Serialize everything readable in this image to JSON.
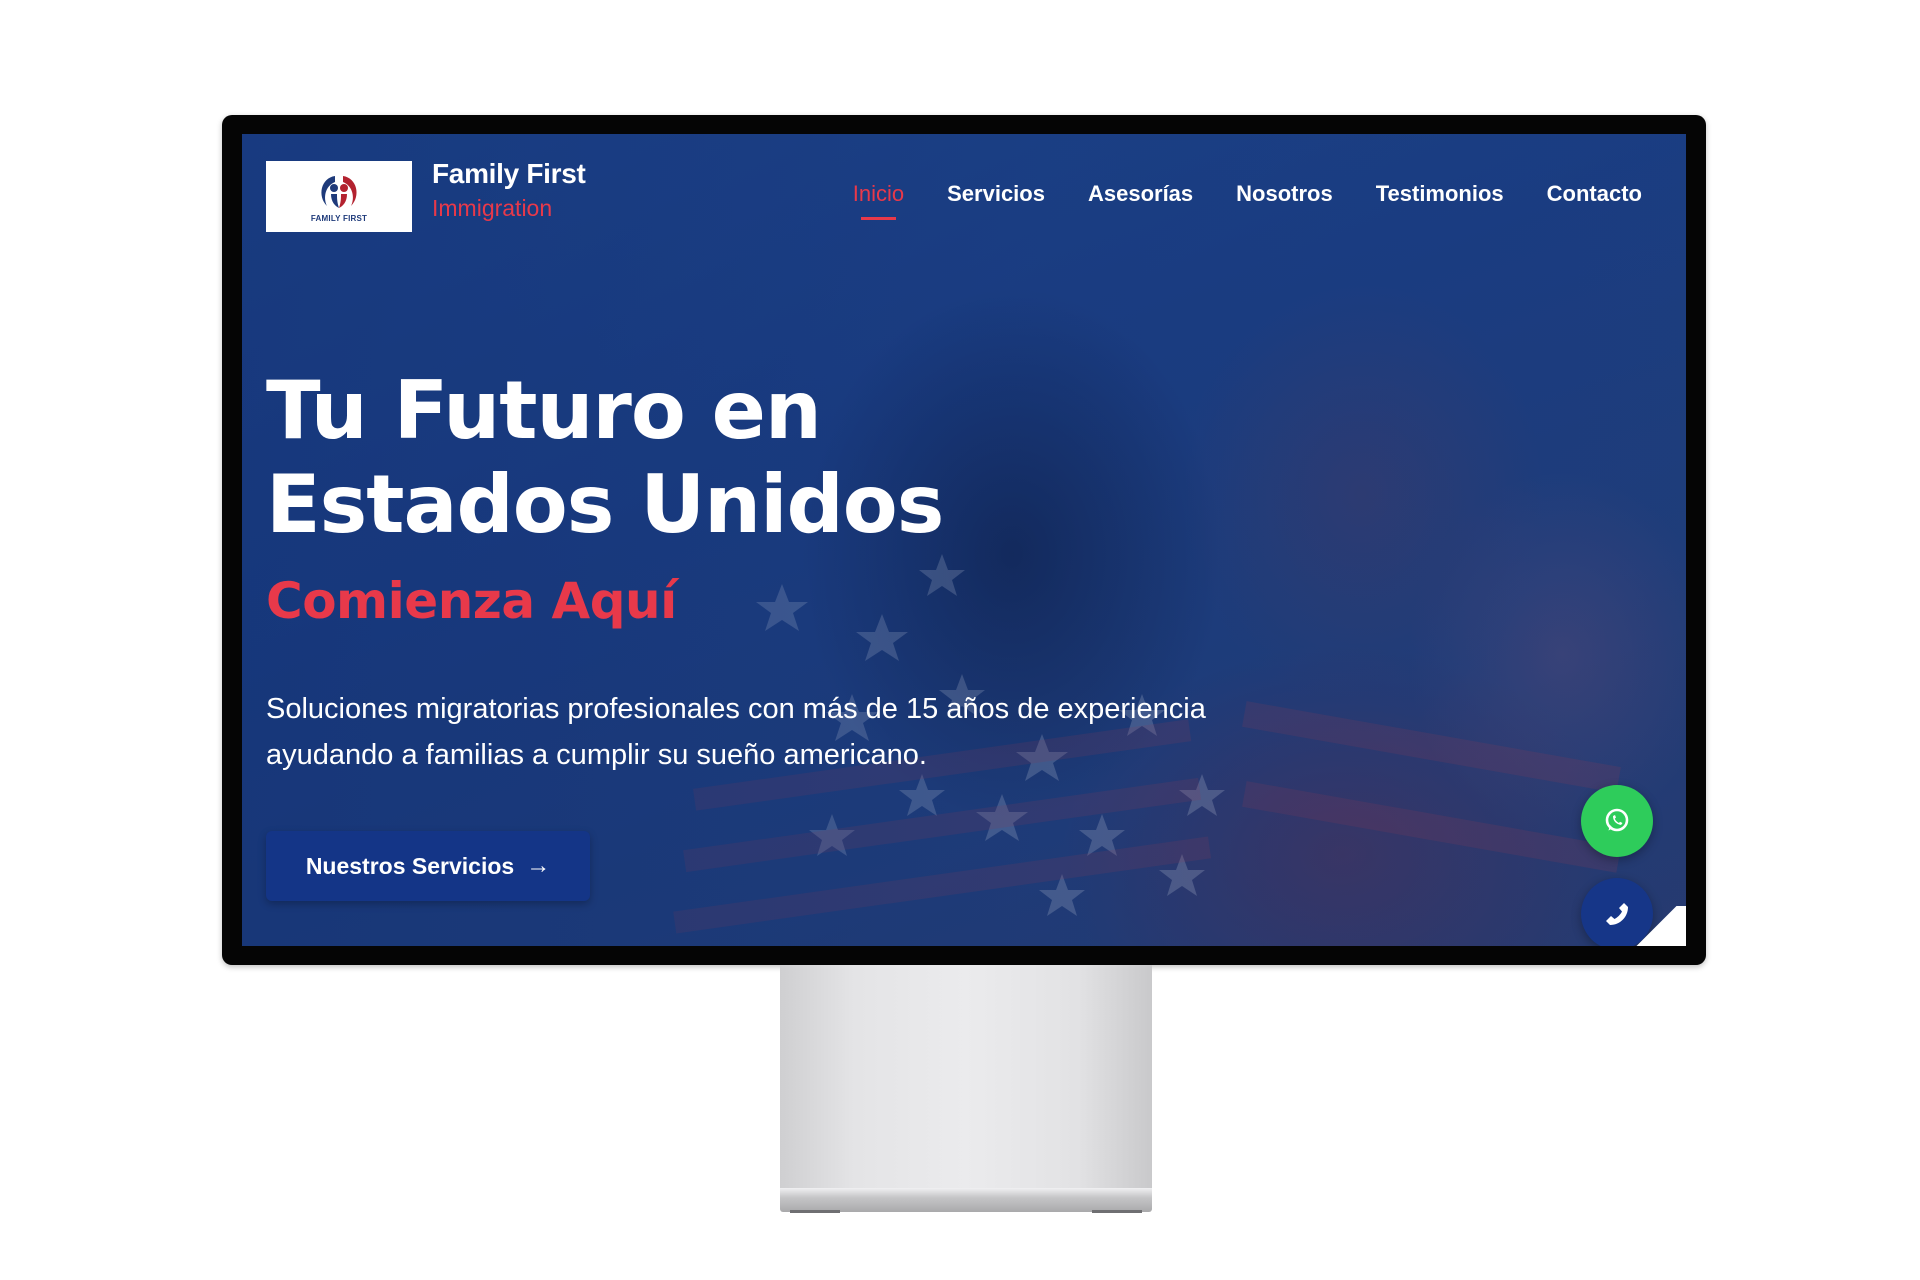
{
  "site": {
    "brand_name": "Family First",
    "brand_sub": "Immigration",
    "logo_caption": "FAMILY FIRST"
  },
  "nav": {
    "items": [
      {
        "label": "Inicio",
        "active": true
      },
      {
        "label": "Servicios",
        "active": false
      },
      {
        "label": "Asesorías",
        "active": false
      },
      {
        "label": "Nosotros",
        "active": false
      },
      {
        "label": "Testimonios",
        "active": false
      },
      {
        "label": "Contacto",
        "active": false
      }
    ]
  },
  "hero": {
    "title": "Tu Futuro en Estados Unidos",
    "tagline": "Comienza Aquí",
    "description": "Soluciones migratorias profesionales con más de 15 años de experiencia ayudando a familias a cumplir su sueño americano.",
    "cta_label": "Nuestros Servicios"
  },
  "floating_actions": {
    "whatsapp_icon": "whatsapp-icon",
    "phone_icon": "phone-icon"
  },
  "colors": {
    "accent_red": "#e8394a",
    "primary_blue": "#143587",
    "whatsapp_green": "#2ecc5b"
  }
}
